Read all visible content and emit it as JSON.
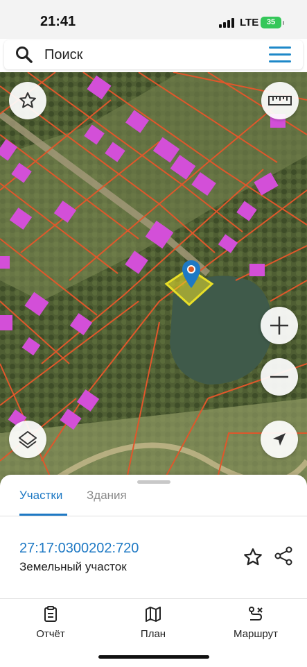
{
  "status_bar": {
    "time": "21:41",
    "network": "LTE",
    "battery": "35"
  },
  "search": {
    "placeholder": "Поиск"
  },
  "map": {
    "icons": [
      "star-icon",
      "ruler-icon",
      "layers-icon",
      "zoom-in-icon",
      "zoom-out-icon",
      "location-arrow-icon",
      "map-pin-icon"
    ],
    "colors": {
      "parcel_border": "#e0572b",
      "building": "#d34fd8",
      "selected_parcel": "#e9df28",
      "water": "#3f5a4a"
    }
  },
  "sheet": {
    "tabs": [
      {
        "label": "Участки",
        "active": true
      },
      {
        "label": "Здания",
        "active": false
      }
    ],
    "result": {
      "cadastral_number": "27:17:0300202:720",
      "type": "Земельный участок"
    }
  },
  "bottom_nav": [
    {
      "label": "Отчёт",
      "icon": "report-icon"
    },
    {
      "label": "План",
      "icon": "map-plan-icon"
    },
    {
      "label": "Маршрут",
      "icon": "route-icon"
    }
  ],
  "accent_color": "#1e79c4"
}
